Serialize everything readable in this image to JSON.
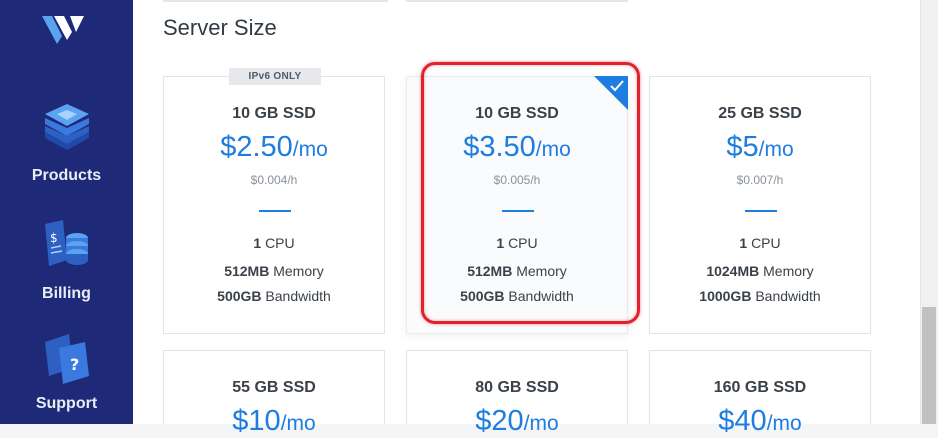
{
  "nav": {
    "items": [
      {
        "label": "Products"
      },
      {
        "label": "Billing"
      },
      {
        "label": "Support"
      }
    ]
  },
  "section": {
    "title": "Server Size"
  },
  "plans": [
    {
      "badge": "IPv6 ONLY",
      "storage": "10 GB SSD",
      "price": "$2.50",
      "per": "/mo",
      "hourly": "$0.004/h",
      "cpu_count": "1",
      "cpu_label": "CPU",
      "memory_value": "512MB",
      "memory_label": "Memory",
      "bandwidth_value": "500GB",
      "bandwidth_label": "Bandwidth"
    },
    {
      "storage": "10 GB SSD",
      "price": "$3.50",
      "per": "/mo",
      "hourly": "$0.005/h",
      "cpu_count": "1",
      "cpu_label": "CPU",
      "memory_value": "512MB",
      "memory_label": "Memory",
      "bandwidth_value": "500GB",
      "bandwidth_label": "Bandwidth",
      "selected": true
    },
    {
      "storage": "25 GB SSD",
      "price": "$5",
      "per": "/mo",
      "hourly": "$0.007/h",
      "cpu_count": "1",
      "cpu_label": "CPU",
      "memory_value": "1024MB",
      "memory_label": "Memory",
      "bandwidth_value": "1000GB",
      "bandwidth_label": "Bandwidth"
    },
    {
      "storage": "55 GB SSD",
      "price": "$10",
      "per": "/mo"
    },
    {
      "storage": "80 GB SSD",
      "price": "$20",
      "per": "/mo"
    },
    {
      "storage": "160 GB SSD",
      "price": "$40",
      "per": "/mo"
    }
  ],
  "colors": {
    "sidebar": "#1e2a78",
    "accent": "#1e7de0",
    "highlight": "#e0222e"
  },
  "icons": {
    "logo": "vultr-logo-icon",
    "products": "layers-icon",
    "billing": "billing-icon",
    "support": "support-icon",
    "check": "check-icon"
  }
}
